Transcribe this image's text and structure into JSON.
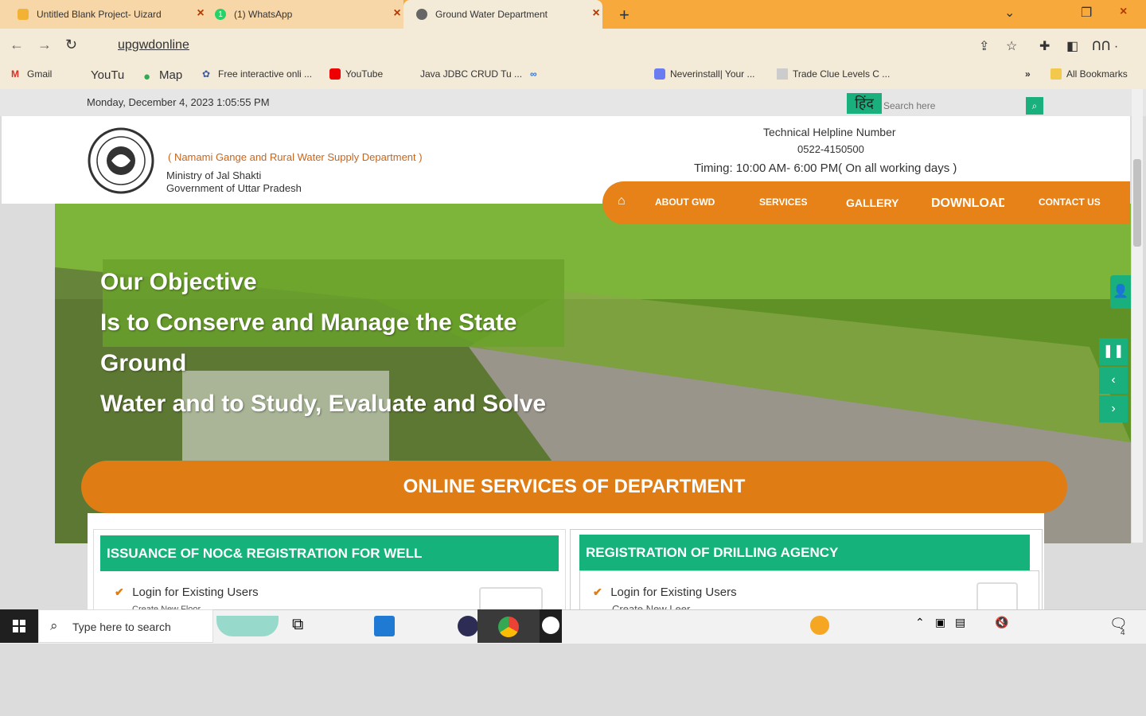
{
  "browser": {
    "tabs": [
      {
        "title": "Untitled Blank Project- Uizard"
      },
      {
        "title": "(1) WhatsApp"
      },
      {
        "title": "Ground Water Department"
      }
    ],
    "address": "upgwdonline",
    "bookmarks": [
      {
        "label": "Gmail"
      },
      {
        "label": "YouTu"
      },
      {
        "label": "Map"
      },
      {
        "label": "Free interactive onli ..."
      },
      {
        "label": "YouTube"
      },
      {
        "label": "Java JDBC CRUD Tu ..."
      },
      {
        "label": "Neverinstall| Your ..."
      },
      {
        "label": "Trade Clue Levels C ..."
      },
      {
        "label": "All Bookmarks"
      }
    ],
    "more_bookmarks": "»",
    "profile": "ᑎᑎ ·"
  },
  "page": {
    "datetime": "Monday, December 4, 2023 1:05:55 PM",
    "hindi_label": "हिंद",
    "search_placeholder": "Search here",
    "dept_name": "( Namami Gange and Rural Water Supply Department )",
    "ministry": "Ministry of Jal Shakti",
    "government": "Government of Uttar Pradesh",
    "helpline_label": "Technical Helpline Number",
    "helpline_number": "0522-4150500",
    "timing": "Timing: 10:00 AM- 6:00 PM( On all working days )",
    "nav": [
      {
        "label": "ABOUT GWD"
      },
      {
        "label": "SERVICES"
      },
      {
        "label": "GALLERY"
      },
      {
        "label": "DOWNLOAD"
      },
      {
        "label": "CONTACT US"
      }
    ],
    "hero_lines": [
      "Our Objective",
      "Is to Conserve and Manage the State",
      "Ground",
      "Water and to Study, Evaluate and Solve"
    ],
    "online_services_title": "ONLINE SERVICES OF DEPARTMENT",
    "cards": [
      {
        "title": "ISSUANCE OF NOC& REGISTRATION FOR WELL",
        "link": "Login for Existing Users",
        "sub": "Create New Floor"
      },
      {
        "title": "REGISTRATION OF DRILLING AGENCY",
        "link": "Login for Existing Users",
        "sub": "Create New Leer"
      }
    ]
  },
  "taskbar": {
    "search_placeholder": "Type here to search",
    "notification_count": "4"
  },
  "colors": {
    "accent_orange": "#e07c14",
    "accent_green": "#15b27c",
    "tab_strip": "#f7a93c"
  }
}
